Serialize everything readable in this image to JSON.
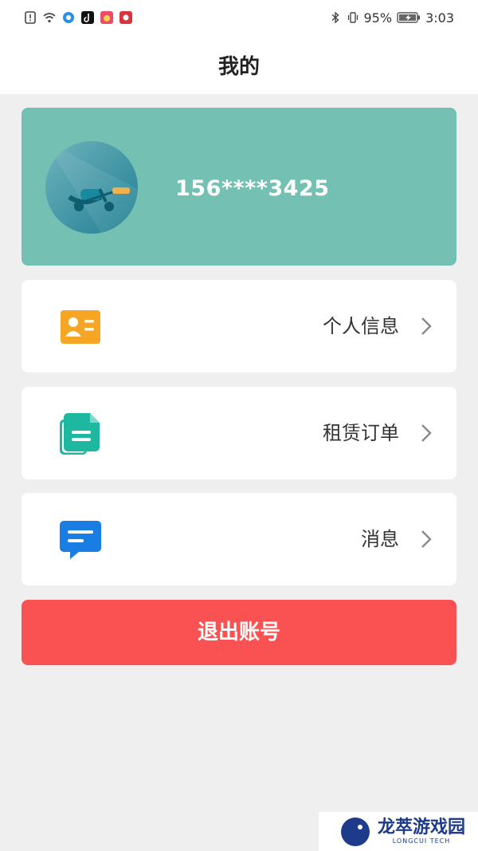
{
  "status_bar": {
    "battery": "95%",
    "time": "3:03"
  },
  "header": {
    "title": "我的"
  },
  "profile": {
    "phone": "156****3425",
    "background_color": "#74c0b3"
  },
  "menu": [
    {
      "label": "个人信息",
      "icon": "id-card-icon",
      "color": "#f6a524"
    },
    {
      "label": "租赁订单",
      "icon": "documents-icon",
      "color": "#1eb8a0"
    },
    {
      "label": "消息",
      "icon": "message-icon",
      "color": "#1a7de4"
    }
  ],
  "logout": {
    "label": "退出账号",
    "color": "#fa5252"
  },
  "watermark": {
    "brand": "龙萃游戏园",
    "sub": "LONGCUI TECH"
  }
}
